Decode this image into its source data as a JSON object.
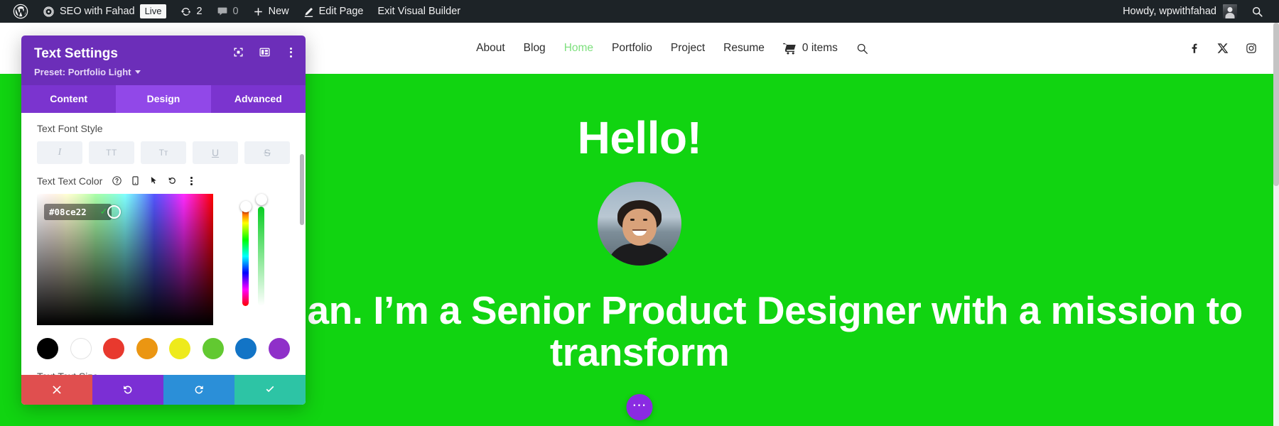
{
  "adminbar": {
    "wp_logo_icon": "wordpress-logo-icon",
    "site_icon": "dashboard-icon",
    "site_name": "SEO with Fahad",
    "live_badge": "Live",
    "updates_icon": "updates-icon",
    "updates_count": "2",
    "comments_icon": "comment-bubble-icon",
    "comments_count": "0",
    "new_icon": "plus-icon",
    "new_label": "New",
    "edit_icon": "pencil-icon",
    "edit_label": "Edit Page",
    "exit_label": "Exit Visual Builder",
    "howdy": "Howdy, wpwithfahad",
    "avatar_icon": "user-avatar",
    "search_icon": "search-icon"
  },
  "site": {
    "nav": [
      {
        "label": "About",
        "active": false
      },
      {
        "label": "Blog",
        "active": false
      },
      {
        "label": "Home",
        "active": true
      },
      {
        "label": "Portfolio",
        "active": false
      },
      {
        "label": "Project",
        "active": false
      },
      {
        "label": "Resume",
        "active": false
      }
    ],
    "cart_icon": "shopping-cart-icon",
    "cart_label": "0 items",
    "search_icon": "search-icon",
    "socials": [
      {
        "name": "facebook-icon"
      },
      {
        "name": "x-twitter-icon"
      },
      {
        "name": "instagram-icon"
      }
    ],
    "hero": {
      "background_color": "#11d411",
      "title": "Hello!",
      "photo_alt": "profile-photo",
      "subtitle": "My name is Brian. I’m a Senior Product Designer with a mission to transform",
      "fab_icon": "more-options-icon",
      "fab_color": "#8a2be2"
    }
  },
  "modal": {
    "title": "Text Settings",
    "preset_label": "Preset: Portfolio Light",
    "header_icons": [
      {
        "name": "focus-target-icon"
      },
      {
        "name": "layout-panel-icon"
      },
      {
        "name": "more-vertical-icon"
      }
    ],
    "tabs": [
      {
        "label": "Content",
        "active": false
      },
      {
        "label": "Design",
        "active": true
      },
      {
        "label": "Advanced",
        "active": false
      }
    ],
    "font_style": {
      "label": "Text Font Style",
      "buttons": [
        {
          "name": "italic-button",
          "glyph": "I"
        },
        {
          "name": "uppercase-button",
          "glyph": "TT"
        },
        {
          "name": "smallcaps-button",
          "glyph": "Tᴛ"
        },
        {
          "name": "underline-button",
          "glyph": "U"
        },
        {
          "name": "strikethrough-button",
          "glyph": "S"
        }
      ]
    },
    "text_color": {
      "label": "Text Text Color",
      "icons": [
        {
          "name": "help-icon"
        },
        {
          "name": "responsive-mobile-icon"
        },
        {
          "name": "hover-cursor-icon"
        },
        {
          "name": "reset-undo-icon"
        },
        {
          "name": "more-vertical-icon"
        }
      ],
      "hex_value": "#08ce22",
      "confirm_icon": "checkmark-icon",
      "swatches": [
        {
          "name": "swatch-black",
          "color": "#000000"
        },
        {
          "name": "swatch-white",
          "color": "#ffffff"
        },
        {
          "name": "swatch-red",
          "color": "#e8392e"
        },
        {
          "name": "swatch-orange",
          "color": "#eb9612"
        },
        {
          "name": "swatch-yellow",
          "color": "#eeea1c"
        },
        {
          "name": "swatch-green",
          "color": "#62c931"
        },
        {
          "name": "swatch-blue",
          "color": "#1274c6"
        },
        {
          "name": "swatch-purple",
          "color": "#8f30c9"
        }
      ]
    },
    "text_size": {
      "label": "Text Text Size"
    },
    "footer": [
      {
        "name": "cancel-button",
        "icon": "close-x-icon",
        "color": "#e04f4f"
      },
      {
        "name": "undo-button",
        "icon": "undo-icon",
        "color": "#7b2fd4"
      },
      {
        "name": "redo-button",
        "icon": "redo-icon",
        "color": "#2b8fd8"
      },
      {
        "name": "save-button",
        "icon": "checkmark-icon",
        "color": "#2dc4a5"
      }
    ]
  }
}
